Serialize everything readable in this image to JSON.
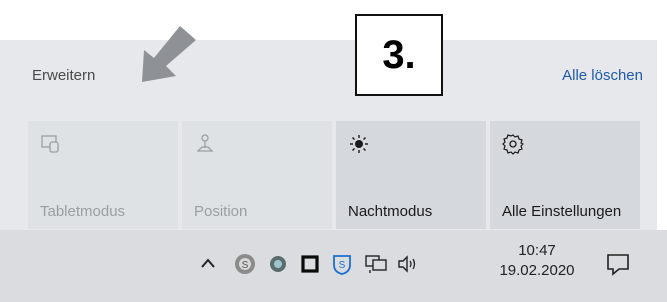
{
  "callout": {
    "step_label": "3."
  },
  "header": {
    "expand_label": "Erweitern",
    "clear_all_label": "Alle löschen"
  },
  "quick_actions": [
    {
      "label": "Tabletmodus",
      "icon": "tablet-mode-icon",
      "enabled": false
    },
    {
      "label": "Position",
      "icon": "location-icon",
      "enabled": false
    },
    {
      "label": "Nachtmodus",
      "icon": "brightness-icon",
      "enabled": true
    },
    {
      "label": "Alle Einstellungen",
      "icon": "gear-icon",
      "enabled": true
    }
  ],
  "taskbar": {
    "tray_icons": [
      "chevron-up-icon",
      "app-s-icon",
      "app-circle-icon",
      "square-icon",
      "shield-icon",
      "network-icon",
      "volume-icon"
    ],
    "clock": {
      "time": "10:47",
      "date": "19.02.2020"
    },
    "notification_icon": "action-center-icon"
  },
  "colors": {
    "accent_link": "#1f5aa8",
    "panel": "#e6e8eb",
    "tile": "#d5d8dc",
    "taskbar": "#dadcdf",
    "shield_blue": "#1c6fd1"
  }
}
